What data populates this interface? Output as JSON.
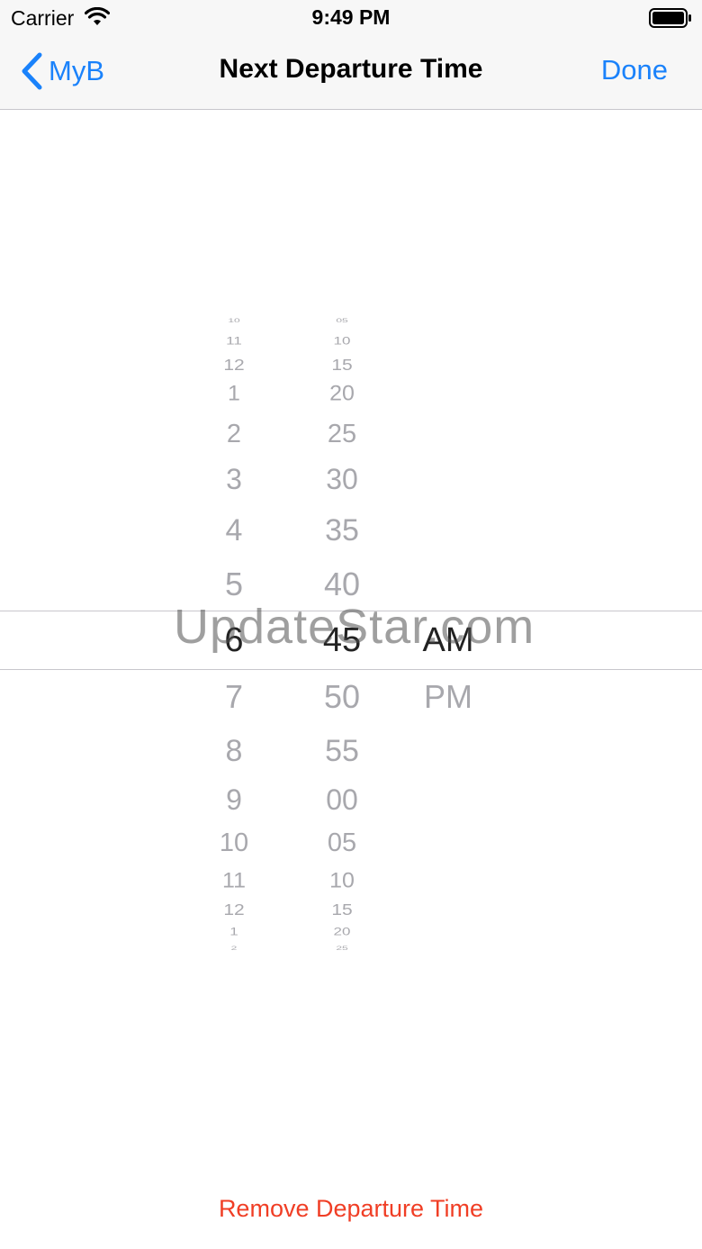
{
  "status_bar": {
    "carrier": "Carrier",
    "time": "9:49 PM",
    "wifi_icon": "wifi-icon",
    "battery_icon": "battery-icon"
  },
  "nav": {
    "back_label": "MyB",
    "back_icon": "chevron-left-icon",
    "title": "Next Departure Time",
    "done_label": "Done",
    "accent_color": "#1a82fb"
  },
  "picker": {
    "hours": [
      "10",
      "11",
      "12",
      "1",
      "2",
      "3",
      "4",
      "5",
      "6",
      "7",
      "8",
      "9",
      "10",
      "11",
      "12",
      "1",
      "2"
    ],
    "minutes": [
      "05",
      "10",
      "15",
      "20",
      "25",
      "30",
      "35",
      "40",
      "45",
      "50",
      "55",
      "00",
      "05",
      "10",
      "15",
      "20",
      "25"
    ],
    "periods": [
      "AM",
      "PM"
    ],
    "selected": {
      "hour": "6",
      "minute": "45",
      "period": "AM"
    }
  },
  "watermark": "UpdateStar.com",
  "remove_label": "Remove Departure Time",
  "remove_color": "#f03e25"
}
